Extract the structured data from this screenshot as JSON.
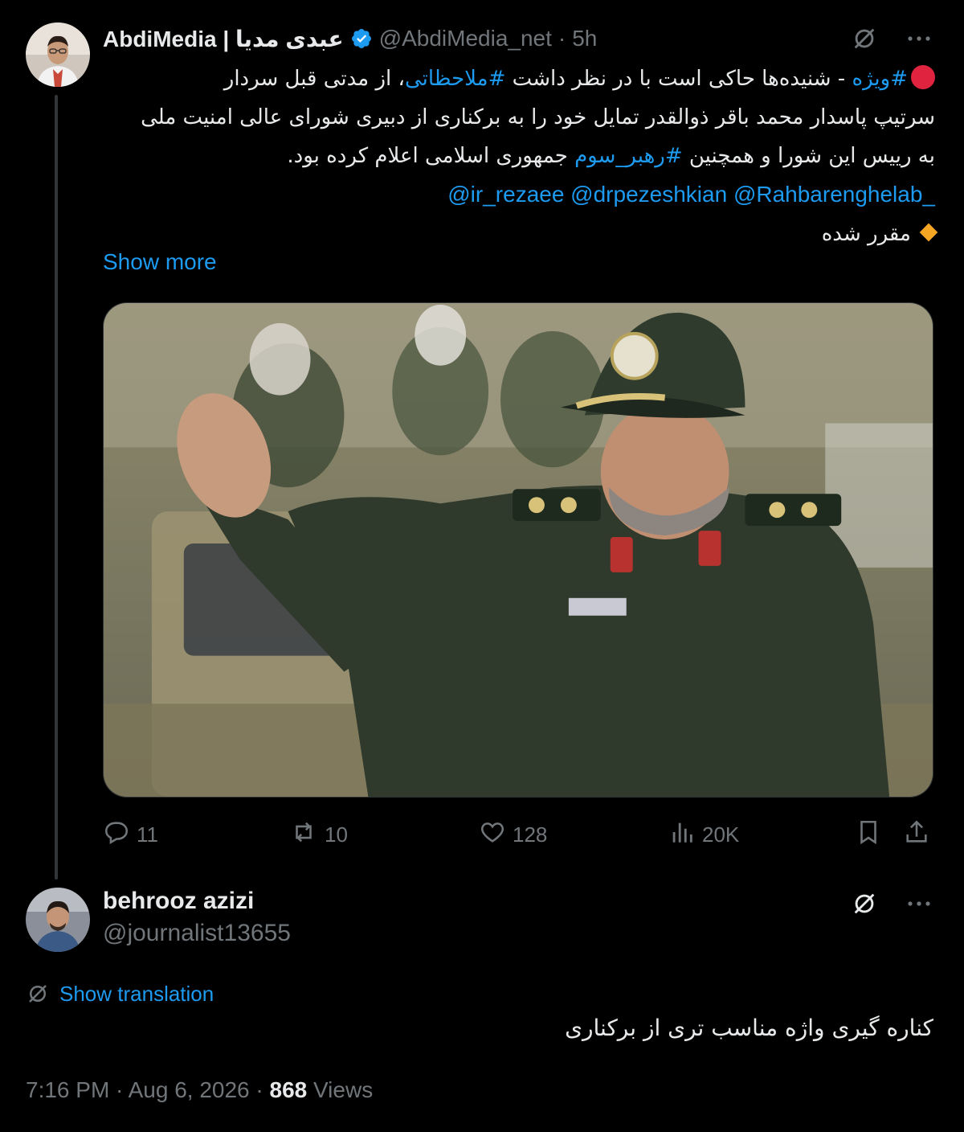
{
  "tweet": {
    "author_name": "AbdiMedia | عبدی مدیا",
    "author_handle": "@AbdiMedia_net",
    "separator": "·",
    "time": "5h",
    "text": {
      "hashtag_1": "#ویژه",
      "part_1": " - شنیده‌ها حاکی است با در نظر داشت ",
      "hashtag_2": "#ملاحظاتی",
      "part_2": "، از مدتی قبل سردار",
      "line_2": "سرتیپ پاسدار محمد باقر ذوالقدر تمایل خود را به برکناری از دبیری شورای عالی امنیت ملی",
      "line_3_start": "به رییس این شورا و همچنین ",
      "hashtag_3": "#رهبر_سوم",
      "line_3_end": " جمهوری اسلامی اعلام کرده بود.",
      "mentions": "@ir_rezaee @drpezeshkian @Rahbarenghelab_",
      "line_5": "مقرر شده"
    },
    "show_more": "Show more",
    "media_alt": "Photo of a uniformed officer in a green cap waving",
    "stats": {
      "replies": "11",
      "reposts": "10",
      "likes": "128",
      "views": "20K"
    }
  },
  "reply": {
    "author_name": "behrooz azizi",
    "author_handle": "@journalist13655",
    "show_translation": "Show translation",
    "text": "کناره گیری واژه مناسب تری از برکناری",
    "timestamp": "7:16 PM · Aug 6, 2026 · ",
    "views_count": "868",
    "views_label": " Views"
  },
  "colors": {
    "background": "#000000",
    "text": "#e7e9ea",
    "secondary": "#71767b",
    "link": "#1d9bf0",
    "divider": "#333639",
    "red_dot": "#e0243f",
    "diamond": "#f5a623"
  },
  "icons": [
    "verified-badge-icon",
    "grok-icon",
    "more-icon",
    "reply-icon",
    "repost-icon",
    "like-icon",
    "views-icon",
    "bookmark-icon",
    "share-icon",
    "translate-icon"
  ]
}
